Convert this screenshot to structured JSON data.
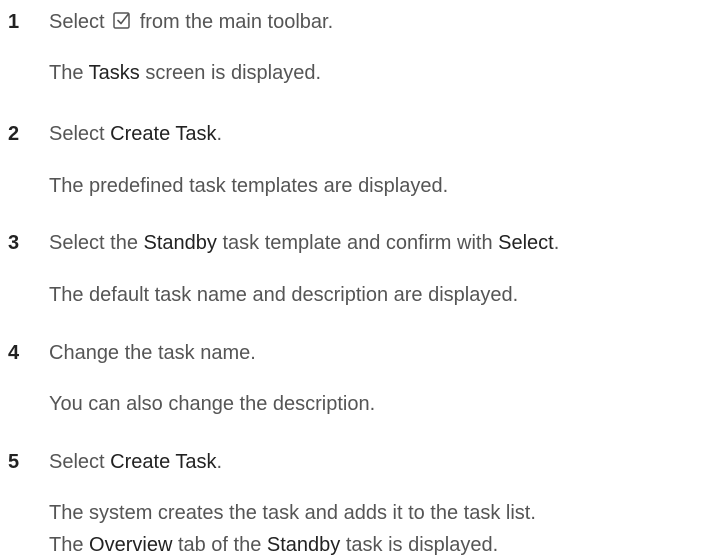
{
  "steps": [
    {
      "number": "1",
      "instruction": {
        "pre": "Select",
        "post": "from the main toolbar.",
        "icon": "task-checkbox-icon"
      },
      "results": [
        {
          "bold": "Tasks",
          "rest": " screen is displayed.",
          "pre": "The "
        }
      ]
    },
    {
      "number": "2",
      "instruction": {
        "pre": "Select ",
        "bold": "Create Task",
        "post": "."
      },
      "results": [
        {
          "text": "The predefined task templates are displayed."
        }
      ]
    },
    {
      "number": "3",
      "instruction": {
        "pre": "Select the ",
        "bold": "Standby",
        "mid": " task template and confirm with ",
        "bold2": "Select",
        "post": "."
      },
      "results": [
        {
          "text": "The default task name and description are displayed."
        }
      ]
    },
    {
      "number": "4",
      "instruction": {
        "text": "Change the task name."
      },
      "results": [
        {
          "text": "You can also change the description."
        }
      ]
    },
    {
      "number": "5",
      "instruction": {
        "pre": "Select ",
        "bold": "Create Task",
        "post": "."
      },
      "results": [
        {
          "text": "The system creates the task and adds it to the task list."
        },
        {
          "pre": "The ",
          "bold": "Overview",
          "mid": " tab of the ",
          "bold2": "Standby",
          "post": " task is displayed."
        }
      ]
    }
  ]
}
